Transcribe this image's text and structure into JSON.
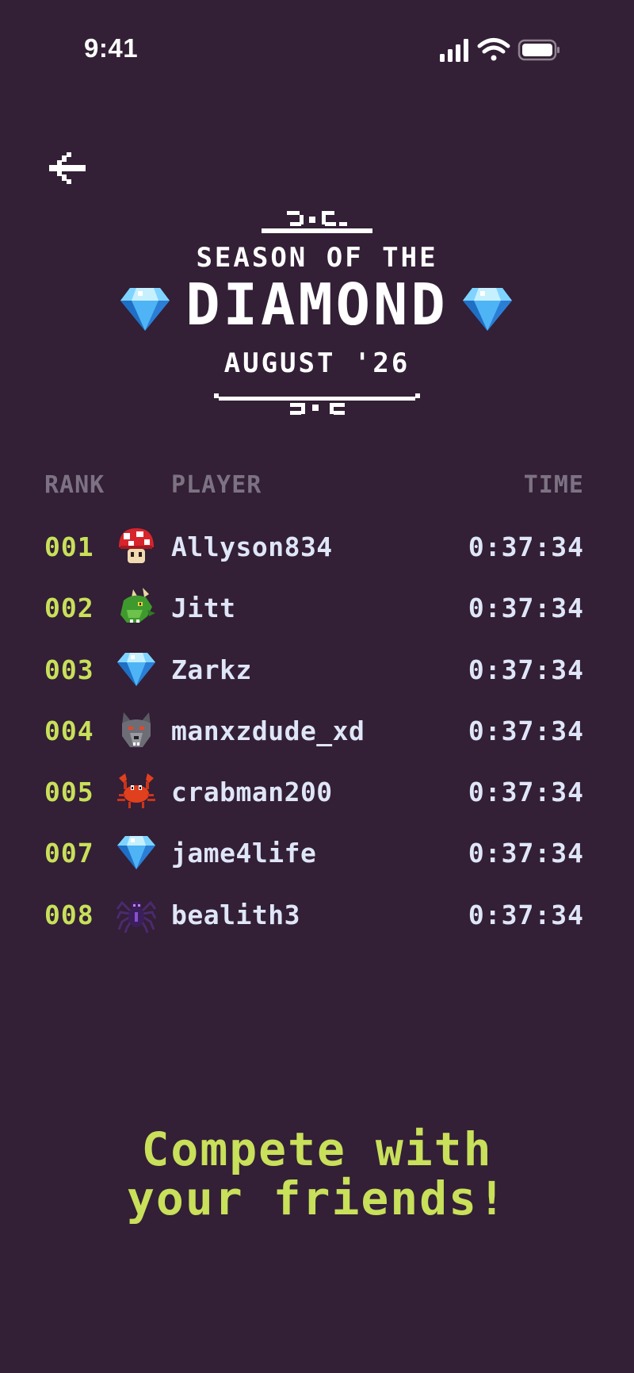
{
  "status_bar": {
    "time": "9:41"
  },
  "nav": {
    "back_icon": "arrow-left-icon"
  },
  "header": {
    "line1": "SEASON OF THE",
    "line2": "DIAMOND",
    "line3": "AUGUST '26",
    "gem_icon": "diamond-gem-icon"
  },
  "leaderboard": {
    "columns": {
      "rank": "RANK",
      "player": "PLAYER",
      "time": "TIME"
    },
    "rows": [
      {
        "rank": "001",
        "player": "Allyson834",
        "time": "0:37:34",
        "avatar": "mushroom-icon"
      },
      {
        "rank": "002",
        "player": "Jitt",
        "time": "0:37:34",
        "avatar": "dragon-icon"
      },
      {
        "rank": "003",
        "player": "Zarkz",
        "time": "0:37:34",
        "avatar": "diamond-gem-icon"
      },
      {
        "rank": "004",
        "player": "manxzdude_xd",
        "time": "0:37:34",
        "avatar": "wolf-icon"
      },
      {
        "rank": "005",
        "player": "crabman200",
        "time": "0:37:34",
        "avatar": "crab-icon"
      },
      {
        "rank": "007",
        "player": "jame4life",
        "time": "0:37:34",
        "avatar": "diamond-gem-icon"
      },
      {
        "rank": "008",
        "player": "bealith3",
        "time": "0:37:34",
        "avatar": "spider-icon"
      }
    ]
  },
  "tagline": {
    "line1": "Compete with",
    "line2": "your friends!"
  },
  "colors": {
    "background": "#331f36",
    "rank_accent": "#c8e05a",
    "player_text": "#dfe6f7",
    "header_text": "#7c7283"
  }
}
